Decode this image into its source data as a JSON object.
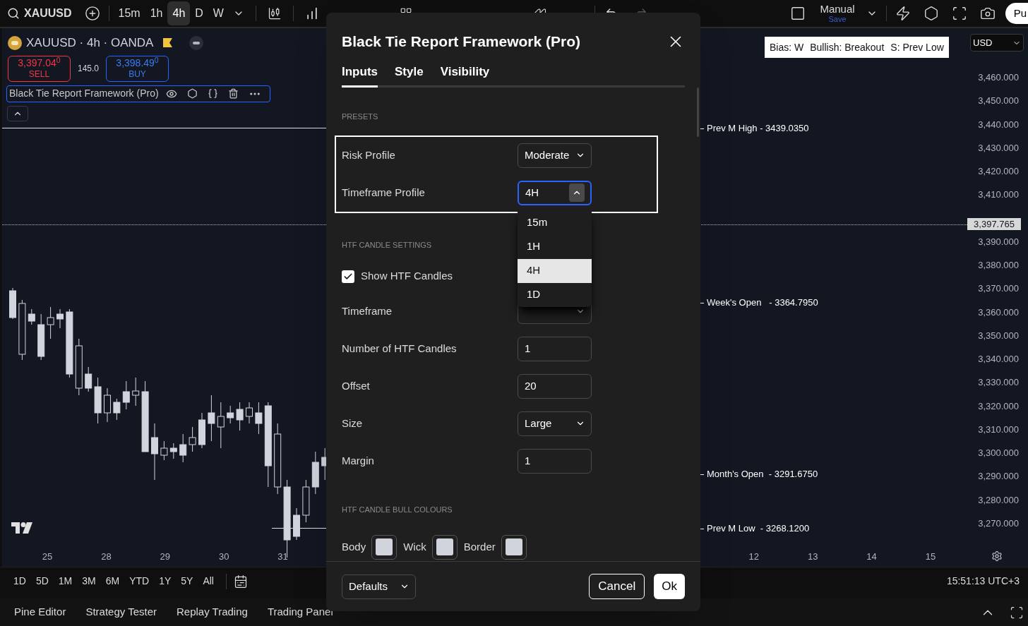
{
  "toolbar": {
    "symbol": "XAUUSD",
    "intervals": [
      {
        "label": "15m",
        "selected": false
      },
      {
        "label": "1h",
        "selected": false
      },
      {
        "label": "4h",
        "selected": true
      },
      {
        "label": "D",
        "selected": false
      },
      {
        "label": "W",
        "selected": false
      }
    ],
    "layout": {
      "name": "Manual",
      "status": "Save"
    },
    "publish": "Pu"
  },
  "chart_header": {
    "title": "XAUUSD · 4h · OANDA",
    "sell": {
      "price": "3,397.04$^{0}$",
      "label": "SELL"
    },
    "spread": "145.0",
    "buy": {
      "price": "3,398.49$^{0}$",
      "label": "BUY"
    },
    "indicator": "Black Tie Report Framework (Pro)"
  },
  "bias_panel": [
    "Bias: W",
    "Bullish: Breakout",
    "S: Prev Low"
  ],
  "currency": "USD",
  "price_axis": [
    "3,460.000",
    "3,450.000",
    "3,440.000",
    "3,430.000",
    "3,420.000",
    "3,410.000",
    "3,390.000",
    "3,380.000",
    "3,370.000",
    "3,360.000",
    "3,350.000",
    "3,340.000",
    "3,330.000",
    "3,320.000",
    "3,310.000",
    "3,300.000",
    "3,290.000",
    "3,280.000",
    "3,270.000"
  ],
  "current_price": "3,397.765",
  "levels": [
    {
      "label": "Prev M High - 3439.0350"
    },
    {
      "label": "Week's Open   - 3364.7950"
    },
    {
      "label": "Month's Open  - 3291.6750"
    },
    {
      "label": "Prev M Low  - 3268.1200"
    }
  ],
  "time_axis": [
    "25",
    "28",
    "29",
    "30",
    "31",
    "12",
    "13",
    "14",
    "15"
  ],
  "ranges": [
    "1D",
    "5D",
    "1M",
    "3M",
    "6M",
    "YTD",
    "1Y",
    "5Y",
    "All"
  ],
  "clock": "15:51:13 UTC+3",
  "bottom_tabs": [
    "Pine Editor",
    "Strategy Tester",
    "Replay Trading",
    "Trading Panel"
  ],
  "dialog": {
    "title": "Black Tie Report Framework (Pro)",
    "tabs": [
      {
        "label": "Inputs",
        "selected": true
      },
      {
        "label": "Style",
        "selected": false
      },
      {
        "label": "Visibility",
        "selected": false
      }
    ],
    "sections": [
      {
        "heading": "PRESETS",
        "highlighted": true,
        "rows": [
          {
            "kind": "select",
            "label": "Risk Profile",
            "value": "Moderate",
            "expanded": false
          },
          {
            "kind": "select",
            "label": "Timeframe Profile",
            "value": "4H",
            "expanded": true,
            "options": [
              {
                "label": "15m",
                "selected": false
              },
              {
                "label": "1H",
                "selected": false
              },
              {
                "label": "4H",
                "selected": true
              },
              {
                "label": "1D",
                "selected": false
              }
            ]
          }
        ]
      },
      {
        "heading": "HTF CANDLE SETTINGS",
        "highlighted": false,
        "rows": [
          {
            "kind": "checkbox",
            "label": "Show HTF Candles",
            "checked": true
          },
          {
            "kind": "select",
            "label": "Timeframe",
            "expanded": false
          },
          {
            "kind": "input",
            "label": "Number of HTF Candles",
            "value": "1"
          },
          {
            "kind": "input",
            "label": "Offset",
            "value": "20"
          },
          {
            "kind": "select",
            "label": "Size",
            "value": "Large",
            "expanded": false
          },
          {
            "kind": "input",
            "label": "Margin",
            "value": "1"
          }
        ]
      },
      {
        "heading": "HTF CANDLE BULL COLOURS",
        "highlighted": false,
        "rows": [
          {
            "kind": "swatches",
            "items": [
              {
                "label": "Body",
                "color": "#d1d4dc"
              },
              {
                "label": "Wick",
                "color": "#d1d4dc"
              },
              {
                "label": "Border",
                "color": "#d1d4dc"
              }
            ]
          }
        ]
      }
    ],
    "footer": {
      "defaults": "Defaults",
      "cancel": "Cancel",
      "ok": "Ok"
    }
  }
}
